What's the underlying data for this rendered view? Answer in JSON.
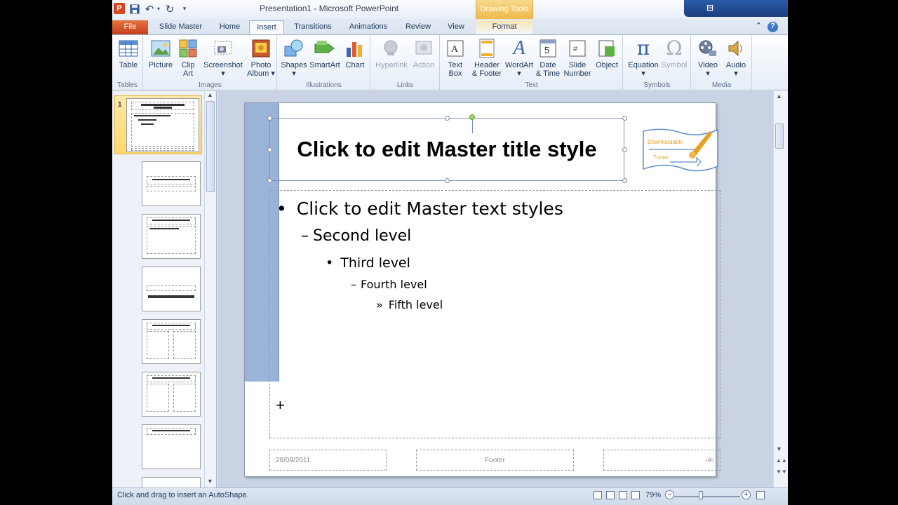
{
  "titlebar": {
    "app_icon": "P",
    "title": "Presentation1  -  Microsoft PowerPoint",
    "contextual_tab_group": "Drawing Tools"
  },
  "tabs": [
    {
      "label": "File"
    },
    {
      "label": "Slide Master"
    },
    {
      "label": "Home"
    },
    {
      "label": "Insert"
    },
    {
      "label": "Transitions"
    },
    {
      "label": "Animations"
    },
    {
      "label": "Review"
    },
    {
      "label": "View"
    },
    {
      "label": "Format"
    }
  ],
  "active_tab": "Insert",
  "ribbon": {
    "groups": {
      "tables": "Tables",
      "images": "Images",
      "illustrations": "Illustrations",
      "links": "Links",
      "text": "Text",
      "symbols": "Symbols",
      "media": "Media"
    },
    "buttons": {
      "table": "Table",
      "picture": "Picture",
      "clip_art_1": "Clip",
      "clip_art_2": "Art",
      "screenshot": "Screenshot",
      "photo_album_1": "Photo",
      "photo_album_2": "Album",
      "shapes": "Shapes",
      "smartart": "SmartArt",
      "chart": "Chart",
      "hyperlink": "Hyperlink",
      "action": "Action",
      "text_box_1": "Text",
      "text_box_2": "Box",
      "header_footer_1": "Header",
      "header_footer_2": "& Footer",
      "wordart": "WordArt",
      "date_time_1": "Date",
      "date_time_2": "& Time",
      "slide_number_1": "Slide",
      "slide_number_2": "Number",
      "object": "Object",
      "equation": "Equation",
      "symbol": "Symbol",
      "video": "Video",
      "audio": "Audio"
    }
  },
  "thumbnails": {
    "selected_number": "1"
  },
  "slide": {
    "title": "Click to edit Master title style",
    "levels": {
      "l1": "Click to edit Master text styles",
      "l2": "Second level",
      "l3": "Third level",
      "l4": "Fourth level",
      "l5": "Fifth level"
    },
    "footer_date": "28/09/2011",
    "footer_center": "Footer",
    "footer_num": "‹#›",
    "logo_line1": "Downloadable",
    "logo_line2": "Tunes"
  },
  "status": {
    "message": "Click and drag to insert an AutoShape.",
    "zoom": "79%"
  },
  "colors": {
    "accent_file": "#d24726",
    "slide_blue_bar": "#9bb3d9",
    "contextual": "#f0b94b"
  }
}
